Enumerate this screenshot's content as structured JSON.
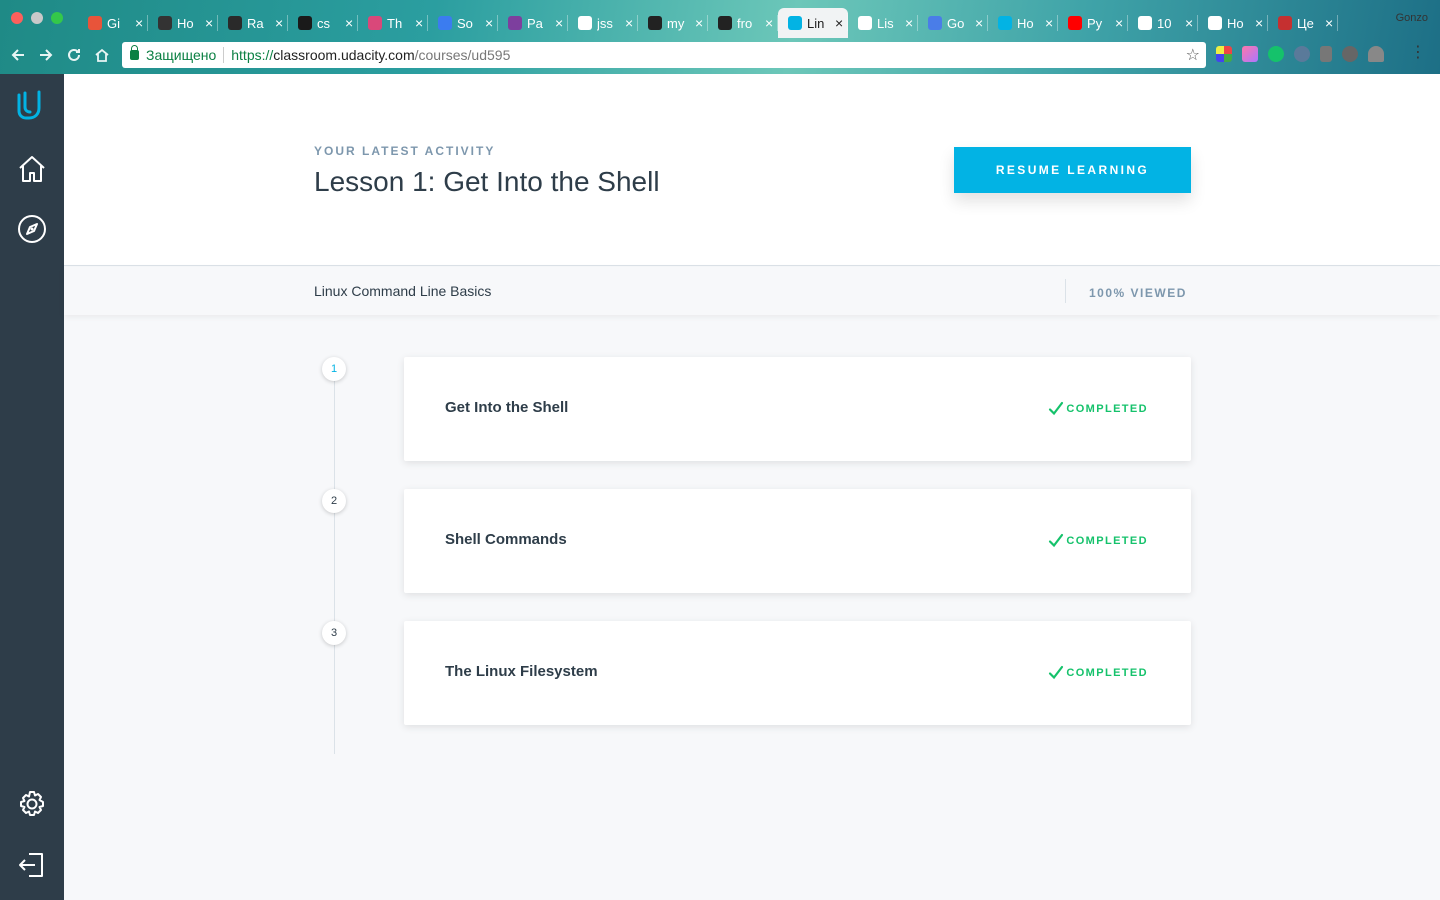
{
  "browser": {
    "profile_name": "Gonzo",
    "tabs": [
      {
        "label": "Gi",
        "icon": "git-icon",
        "color": "#e8543a"
      },
      {
        "label": "Ho",
        "icon": "ninja-icon",
        "color": "#333333"
      },
      {
        "label": "Ra",
        "icon": "terminal-icon",
        "color": "#2a2a2a"
      },
      {
        "label": "cs",
        "icon": "css-icon",
        "color": "#1a1a1a"
      },
      {
        "label": "Th",
        "icon": "medium-icon",
        "color": "#d9487a"
      },
      {
        "label": "So",
        "icon": "blue-drop-icon",
        "color": "#3b7cf0"
      },
      {
        "label": "Pa",
        "icon": "purple-circle-icon",
        "color": "#7d3f9e"
      },
      {
        "label": "jss",
        "icon": "google-icon",
        "color": "#ffffff"
      },
      {
        "label": "my",
        "icon": "github-icon",
        "color": "#222222"
      },
      {
        "label": "fro",
        "icon": "github-icon",
        "color": "#222222"
      },
      {
        "label": "Lin",
        "icon": "udacity-icon",
        "color": "#02b3e4",
        "active": true
      },
      {
        "label": "Lis",
        "icon": "wikipedia-icon",
        "color": "#ffffff"
      },
      {
        "label": "Go",
        "icon": "translate-icon",
        "color": "#4a7de8"
      },
      {
        "label": "Ho",
        "icon": "udacity-icon",
        "color": "#02b3e4"
      },
      {
        "label": "Py",
        "icon": "youtube-icon",
        "color": "#ff0000"
      },
      {
        "label": "10",
        "icon": "file-icon",
        "color": "#ffffff"
      },
      {
        "label": "Ho",
        "icon": "file-icon",
        "color": "#ffffff"
      },
      {
        "label": "Це",
        "icon": "red-logo-icon",
        "color": "#c53030"
      }
    ],
    "secure_label": "Защищено",
    "url_scheme": "https://",
    "url_host": "classroom.udacity.com",
    "url_path": "/courses/ud595"
  },
  "sidebar": {
    "items": [
      "udacity-logo-icon",
      "home-icon",
      "compass-icon",
      "gear-icon",
      "logout-icon"
    ]
  },
  "hero": {
    "eyebrow": "YOUR LATEST ACTIVITY",
    "title": "Lesson 1: Get Into the Shell",
    "resume_label": "RESUME LEARNING"
  },
  "course": {
    "name": "Linux Command Line Basics",
    "progress_label": "100% VIEWED"
  },
  "lessons": [
    {
      "number": "1",
      "title": "Get Into the Shell",
      "status": "COMPLETED"
    },
    {
      "number": "2",
      "title": "Shell Commands",
      "status": "COMPLETED"
    },
    {
      "number": "3",
      "title": "The Linux Filesystem",
      "status": "COMPLETED"
    }
  ],
  "colors": {
    "accent": "#02b3e4",
    "sidebar": "#2e3d49",
    "completed": "#15c26b"
  }
}
